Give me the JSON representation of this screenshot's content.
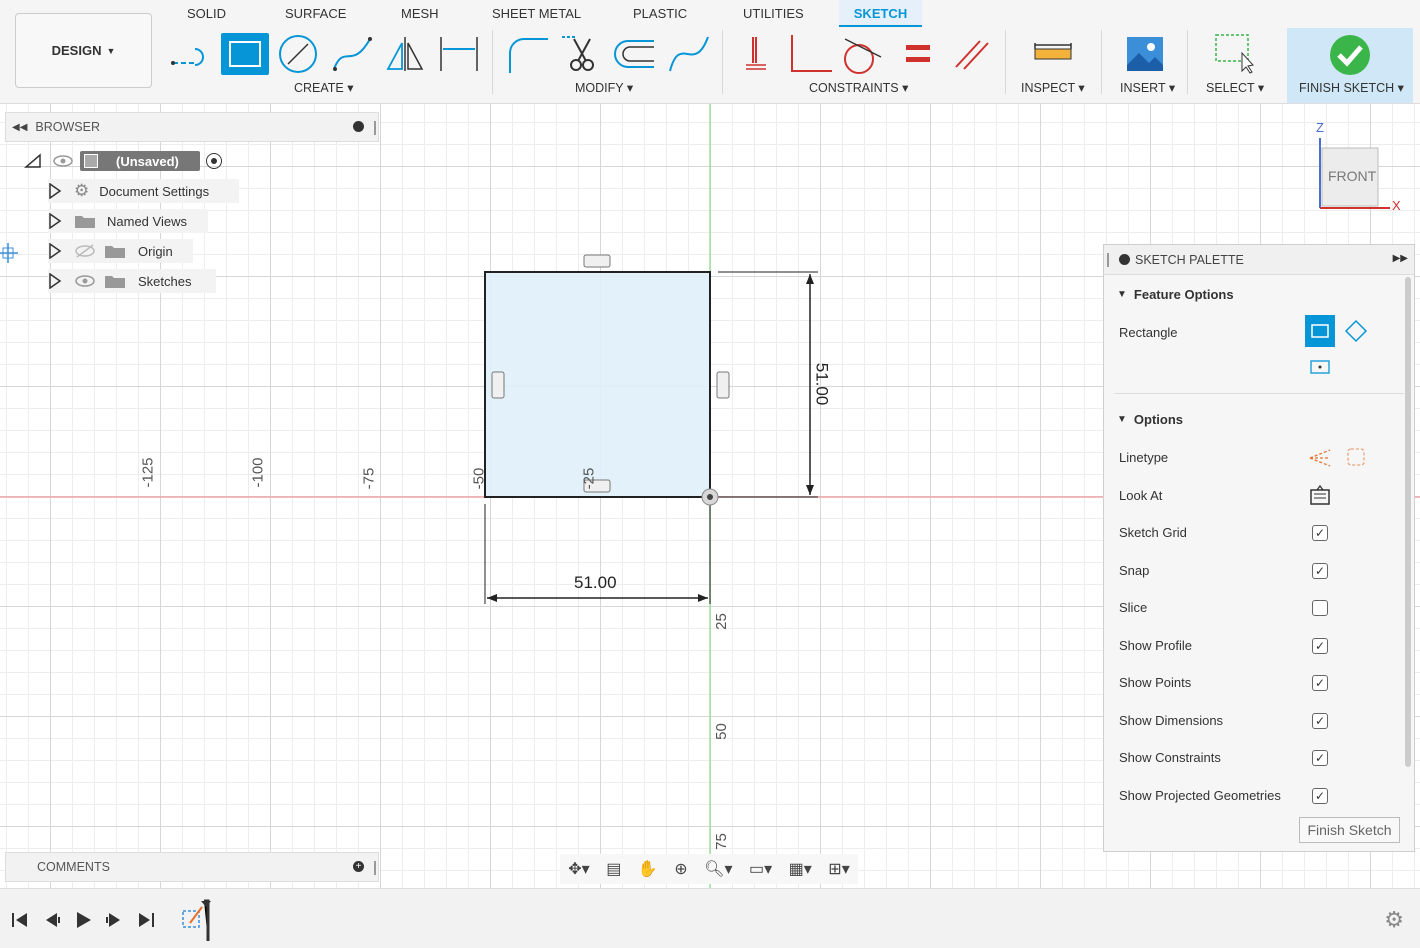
{
  "toolbar": {
    "workspace": "DESIGN",
    "tabs": [
      "SOLID",
      "SURFACE",
      "MESH",
      "SHEET METAL",
      "PLASTIC",
      "UTILITIES",
      "SKETCH"
    ],
    "groups": {
      "create": "CREATE",
      "modify": "MODIFY",
      "constraints": "CONSTRAINTS",
      "inspect": "INSPECT",
      "insert": "INSERT",
      "select": "SELECT",
      "finish": "FINISH SKETCH"
    },
    "accent": "#0696d7"
  },
  "browser": {
    "title": "BROWSER",
    "root": "(Unsaved)",
    "items": [
      "Document Settings",
      "Named Views",
      "Origin",
      "Sketches"
    ]
  },
  "comments": {
    "title": "COMMENTS"
  },
  "viewcube": {
    "face": "FRONT",
    "z": "Z",
    "x": "X"
  },
  "sketch": {
    "width_dim": "51.00",
    "height_dim": "51.00",
    "axis_labels": [
      "-125",
      "-100",
      "-75",
      "-50",
      "-25",
      "25",
      "50",
      "75"
    ]
  },
  "palette": {
    "title": "SKETCH PALETTE",
    "feature_options_title": "Feature Options",
    "rectangle_label": "Rectangle",
    "options_title": "Options",
    "linetype_label": "Linetype",
    "lookat_label": "Look At",
    "options": [
      {
        "label": "Sketch Grid",
        "checked": true
      },
      {
        "label": "Snap",
        "checked": true
      },
      {
        "label": "Slice",
        "checked": false
      },
      {
        "label": "Show Profile",
        "checked": true
      },
      {
        "label": "Show Points",
        "checked": true
      },
      {
        "label": "Show Dimensions",
        "checked": true
      },
      {
        "label": "Show Constraints",
        "checked": true
      },
      {
        "label": "Show Projected Geometries",
        "checked": true
      }
    ],
    "finish_button": "Finish Sketch"
  }
}
